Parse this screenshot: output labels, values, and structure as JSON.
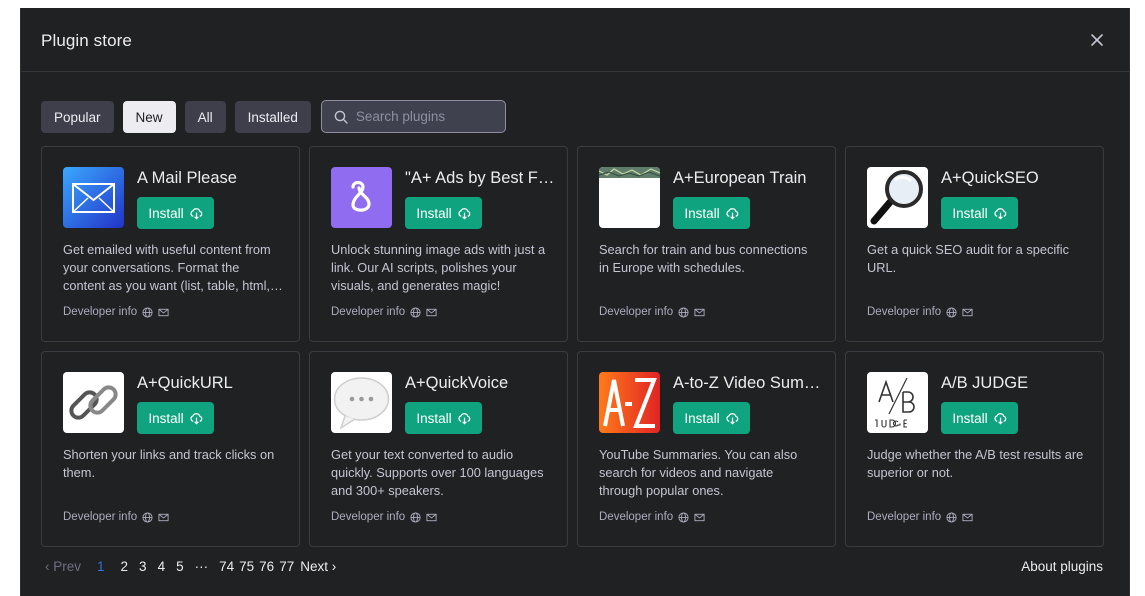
{
  "modal": {
    "title": "Plugin store",
    "close_icon": "close-icon"
  },
  "filters": {
    "tabs": [
      {
        "label": "Popular",
        "active": false
      },
      {
        "label": "New",
        "active": true
      },
      {
        "label": "All",
        "active": false
      },
      {
        "label": "Installed",
        "active": false
      }
    ],
    "search_placeholder": "Search plugins"
  },
  "install_label": "Install",
  "developer_info_label": "Developer info",
  "plugins": [
    {
      "name": "A Mail Please",
      "icon": "mail-envelope",
      "description": "Get emailed with useful content from your conversations. Format the content as you want (list, table, html, etc.)"
    },
    {
      "name": "\"A+ Ads by Best Future\"",
      "icon": "ads-logo",
      "description": "Unlock stunning image ads with just a link. Our AI scripts, polishes your visuals, and generates magic!"
    },
    {
      "name": "A+European Train",
      "icon": "train-map",
      "description": "Search for train and bus connections in Europe with schedules."
    },
    {
      "name": "A+QuickSEO",
      "icon": "magnifier",
      "description": "Get a quick SEO audit for a specific URL."
    },
    {
      "name": "A+QuickURL",
      "icon": "chain-link",
      "description": "Shorten your links and track clicks on them."
    },
    {
      "name": "A+QuickVoice",
      "icon": "speech-bubble",
      "description": "Get your text converted to audio quickly. Supports over 100 languages and 300+ speakers."
    },
    {
      "name": "A-to-Z Video Summary",
      "icon": "a-z-logo",
      "description": "YouTube Summaries. You can also search for videos and navigate through popular ones."
    },
    {
      "name": "A/B JUDGE",
      "icon": "ab-judge-logo",
      "description": "Judge whether the A/B test results are superior or not."
    }
  ],
  "pagination": {
    "prev": "‹ Prev",
    "current": "1",
    "pages": [
      "2",
      "3",
      "4",
      "5",
      "···",
      "74",
      "75",
      "76",
      "77"
    ],
    "next": "Next ›"
  },
  "about_label": "About plugins",
  "colors": {
    "background": "#202123",
    "accent": "#10a37f",
    "current_page": "#2f6fdb"
  }
}
